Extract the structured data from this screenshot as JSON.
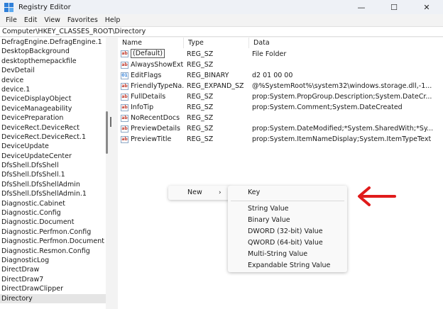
{
  "window": {
    "title": "Registry Editor",
    "controls": {
      "minimize": "—",
      "maximize": "☐",
      "close": "✕"
    }
  },
  "menubar": [
    "File",
    "Edit",
    "View",
    "Favorites",
    "Help"
  ],
  "address": "Computer\\HKEY_CLASSES_ROOT\\Directory",
  "tree": {
    "items": [
      "DefragEngine.DefragEngine.1",
      "DesktopBackground",
      "desktopthemepackfile",
      "DevDetail",
      "device",
      "device.1",
      "DeviceDisplayObject",
      "DeviceManageability",
      "DevicePreparation",
      "DeviceRect.DeviceRect",
      "DeviceRect.DeviceRect.1",
      "DeviceUpdate",
      "DeviceUpdateCenter",
      "DfsShell.DfsShell",
      "DfsShell.DfsShell.1",
      "DfsShell.DfsShellAdmin",
      "DfsShell.DfsShellAdmin.1",
      "Diagnostic.Cabinet",
      "Diagnostic.Config",
      "Diagnostic.Document",
      "Diagnostic.Perfmon.Config",
      "Diagnostic.Perfmon.Document",
      "Diagnostic.Resmon.Config",
      "DiagnosticLog",
      "DirectDraw",
      "DirectDraw7",
      "DirectDrawClipper",
      "Directory"
    ],
    "selected": "Directory"
  },
  "values": {
    "columns": {
      "name": "Name",
      "type": "Type",
      "data": "Data"
    },
    "rows": [
      {
        "name": "(Default)",
        "type": "REG_SZ",
        "data": "File Folder",
        "icon": "ab"
      },
      {
        "name": "AlwaysShowExt",
        "type": "REG_SZ",
        "data": "",
        "icon": "ab"
      },
      {
        "name": "EditFlags",
        "type": "REG_BINARY",
        "data": "d2 01 00 00",
        "icon": "bin"
      },
      {
        "name": "FriendlyTypeNa...",
        "type": "REG_EXPAND_SZ",
        "data": "@%SystemRoot%\\system32\\windows.storage.dll,-1...",
        "icon": "ab"
      },
      {
        "name": "FullDetails",
        "type": "REG_SZ",
        "data": "prop:System.PropGroup.Description;System.DateCr...",
        "icon": "ab"
      },
      {
        "name": "InfoTip",
        "type": "REG_SZ",
        "data": "prop:System.Comment;System.DateCreated",
        "icon": "ab"
      },
      {
        "name": "NoRecentDocs",
        "type": "REG_SZ",
        "data": "",
        "icon": "ab"
      },
      {
        "name": "PreviewDetails",
        "type": "REG_SZ",
        "data": "prop:System.DateModified;*System.SharedWith;*Sy...",
        "icon": "ab"
      },
      {
        "name": "PreviewTitle",
        "type": "REG_SZ",
        "data": "prop:System.ItemNameDisplay;System.ItemTypeText",
        "icon": "ab"
      }
    ]
  },
  "context_menu": {
    "new_label": "New",
    "chevron": "›"
  },
  "submenu": {
    "items": [
      "Key",
      "String Value",
      "Binary Value",
      "DWORD (32-bit) Value",
      "QWORD (64-bit) Value",
      "Multi-String Value",
      "Expandable String Value"
    ]
  },
  "colors": {
    "annotation_arrow": "#e01b1b",
    "selection": "#e5e5e5",
    "icon_accent": "#2f7fd8"
  }
}
